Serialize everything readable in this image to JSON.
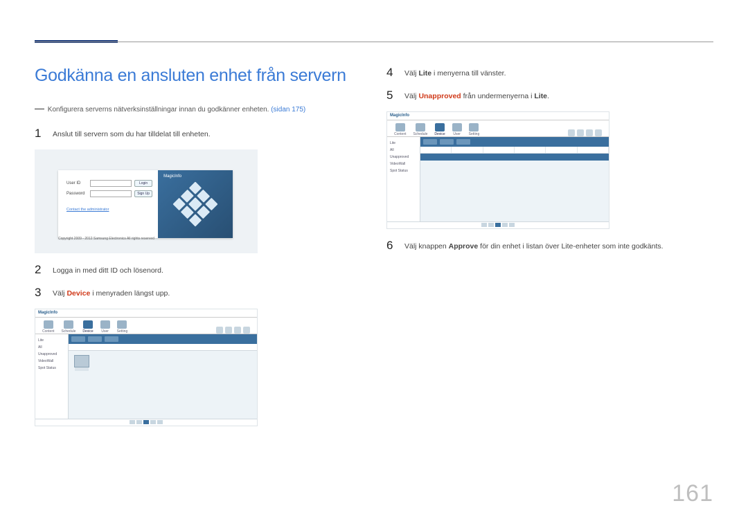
{
  "page_number": "161",
  "title": "Godkänna en ansluten enhet från servern",
  "note": {
    "prefix": "―",
    "text": "Konfigurera serverns nätverksinställningar innan du godkänner enheten. ",
    "link": "(sidan 175)"
  },
  "steps_left": [
    {
      "num": "1",
      "parts": [
        {
          "t": "Anslut till servern som du har tilldelat till enheten."
        }
      ]
    },
    {
      "num": "2",
      "parts": [
        {
          "t": "Logga in med ditt ID och lösenord."
        }
      ]
    },
    {
      "num": "3",
      "parts": [
        {
          "t": "Välj "
        },
        {
          "t": "Device",
          "cls": "hl"
        },
        {
          "t": " i menyraden längst upp."
        }
      ]
    }
  ],
  "steps_right": [
    {
      "num": "4",
      "parts": [
        {
          "t": "Välj "
        },
        {
          "t": "Lite",
          "cls": "bold"
        },
        {
          "t": " i menyerna till vänster."
        }
      ]
    },
    {
      "num": "5",
      "parts": [
        {
          "t": "Välj "
        },
        {
          "t": "Unapproved",
          "cls": "hl"
        },
        {
          "t": " från undermenyerna i "
        },
        {
          "t": "Lite",
          "cls": "bold"
        },
        {
          "t": "."
        }
      ]
    },
    {
      "num": "6",
      "parts": [
        {
          "t": "Välj knappen "
        },
        {
          "t": "Approve",
          "cls": "bold"
        },
        {
          "t": " för din enhet i listan över Lite-enheter som inte godkänts."
        }
      ]
    }
  ],
  "login_shot": {
    "brand": "MagicInfo",
    "user_label": "User ID",
    "pass_label": "Password",
    "login_btn": "Login",
    "signup_btn": "Sign Up",
    "contact": "Contact the administrator",
    "copyright": "Copyright 2009 - 2012 Samsung Electronics All rights reserved"
  },
  "app_shot": {
    "logo": "MagicInfo",
    "tabs": [
      "Content",
      "Schedule",
      "Device",
      "User",
      "Setting"
    ],
    "side_items": [
      "Lite",
      "All",
      "Unapproved",
      "VideoWall",
      "Spot Status"
    ]
  }
}
